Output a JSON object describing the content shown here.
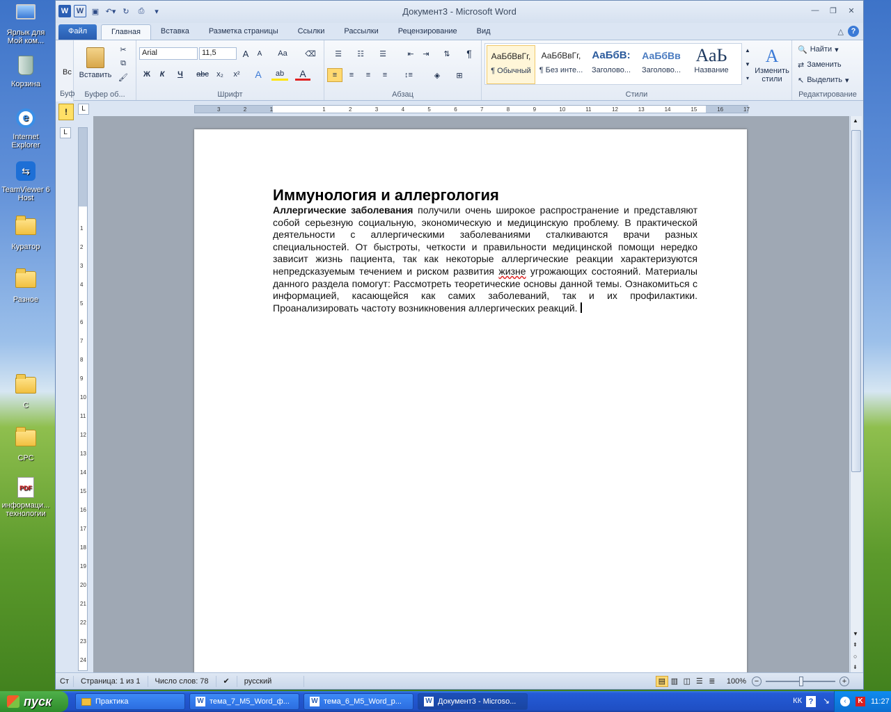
{
  "desktop": {
    "icons": [
      {
        "label": "Ярлык для Мой ком..."
      },
      {
        "label": "Корзина"
      },
      {
        "label": "Internet Explorer"
      },
      {
        "label": "TeamViewer 6 Host"
      },
      {
        "label": "Куратор"
      },
      {
        "label": "Разное"
      },
      {
        "label": "С"
      },
      {
        "label": "СРС"
      },
      {
        "label": "информаци... технологии"
      }
    ]
  },
  "window": {
    "title": "Документ3 - Microsoft Word"
  },
  "tabs": {
    "file": "Файл",
    "items": [
      "Главная",
      "Вставка",
      "Разметка страницы",
      "Ссылки",
      "Рассылки",
      "Рецензирование",
      "Вид"
    ]
  },
  "ribbon": {
    "clipboard": {
      "paste": "Вставить",
      "label": "Буфер об..."
    },
    "font": {
      "name": "Arial",
      "size": "11,5",
      "label": "Шрифт",
      "bold": "Ж",
      "italic": "К",
      "underline": "Ч",
      "strike": "abc",
      "sub": "x₂",
      "sup": "x²",
      "grow": "A",
      "shrink": "A",
      "case": "Аа"
    },
    "paragraph": {
      "label": "Абзац",
      "pilcrow": "¶"
    },
    "styles": {
      "label": "Стили",
      "items": [
        {
          "sample": "АаБбВвГг,",
          "name": "¶ Обычный"
        },
        {
          "sample": "АаБбВвГг,",
          "name": "¶ Без инте..."
        },
        {
          "sample": "АаБбВ:",
          "name": "Заголово..."
        },
        {
          "sample": "АаБбВв",
          "name": "Заголово..."
        },
        {
          "sample": "АаЬ",
          "name": "Название"
        }
      ],
      "change": "Изменить стили"
    },
    "editing": {
      "label": "Редактирование",
      "find": "Найти",
      "replace": "Заменить",
      "select": "Выделить"
    }
  },
  "left_panel": {
    "cut_label": "Вс",
    "clipboard_label": "Буф"
  },
  "document": {
    "title": "Иммунология и аллергология",
    "lead_bold": "Аллергические заболевания",
    "body_1": " получили очень широкое распространение и представляют собой серьезную социальную, экономическую и медицинскую проблему. В практической деятельности с аллергическими заболеваниями сталкиваются врачи разных специальностей. От быстроты, четкости и правильности медицинской помощи нередко зависит жизнь пациента, так как некоторые аллергические реакции характеризуются непредсказуемым течением и риском развития ",
    "misspelled": "жизне",
    "body_2": " угрожающих состояний. Материалы данного раздела помогут: Рассмотреть теоретические основы данной темы. Ознакомиться с информацией, касающейся как самих заболеваний, так и их профилактики. Проанализировать частоту возникновения аллергических реакций."
  },
  "statusbar": {
    "left": "Ст",
    "page": "Страница: 1 из 1",
    "words": "Число слов: 78",
    "language": "русский",
    "zoom": "100%"
  },
  "taskbar": {
    "start": "пуск",
    "buttons": [
      "Практика",
      "тема_7_M5_Word_ф...",
      "тема_6_M5_Word_р...",
      "Документ3 - Microso..."
    ],
    "lang": "КК",
    "clock": "11:27"
  }
}
